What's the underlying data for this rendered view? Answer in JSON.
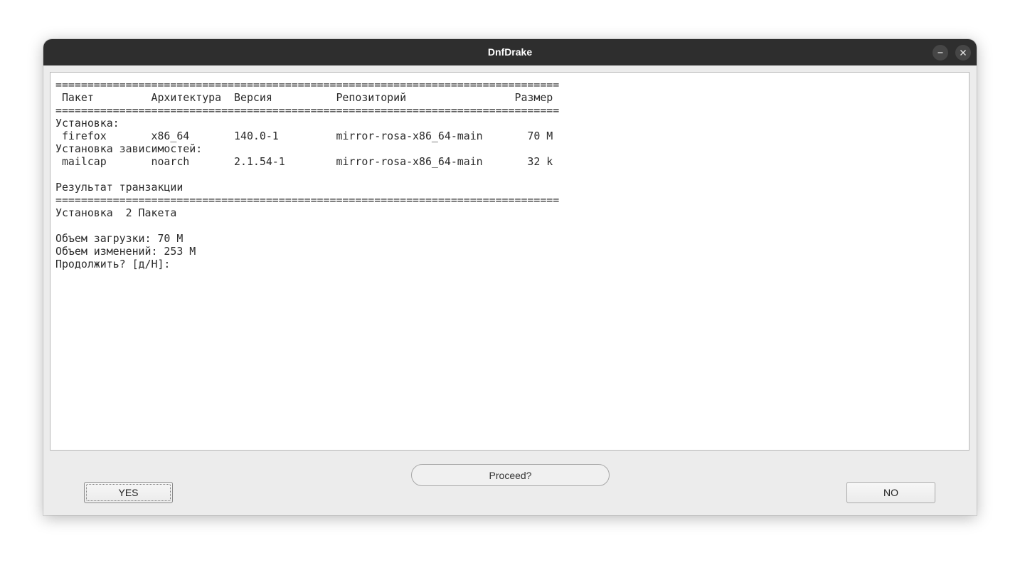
{
  "window": {
    "title": "DnfDrake"
  },
  "titlebar_buttons": {
    "minimize_icon": "minimize-icon",
    "close_icon": "close-icon"
  },
  "terminal": {
    "lines": [
      "===============================================================================",
      " Пакет         Архитектура  Версия          Репозиторий                 Размер",
      "===============================================================================",
      "Установка:",
      " firefox       x86_64       140.0-1         mirror-rosa-x86_64-main       70 M",
      "Установка зависимостей:",
      " mailcap       noarch       2.1.54-1        mirror-rosa-x86_64-main       32 k",
      "",
      "Результат транзакции",
      "===============================================================================",
      "Установка  2 Пакета",
      "",
      "Объем загрузки: 70 M",
      "Объем изменений: 253 M",
      "Продолжить? [д/Н]:"
    ]
  },
  "dialog": {
    "prompt_label": "Proceed?",
    "yes_label": "YES",
    "no_label": "NO"
  }
}
